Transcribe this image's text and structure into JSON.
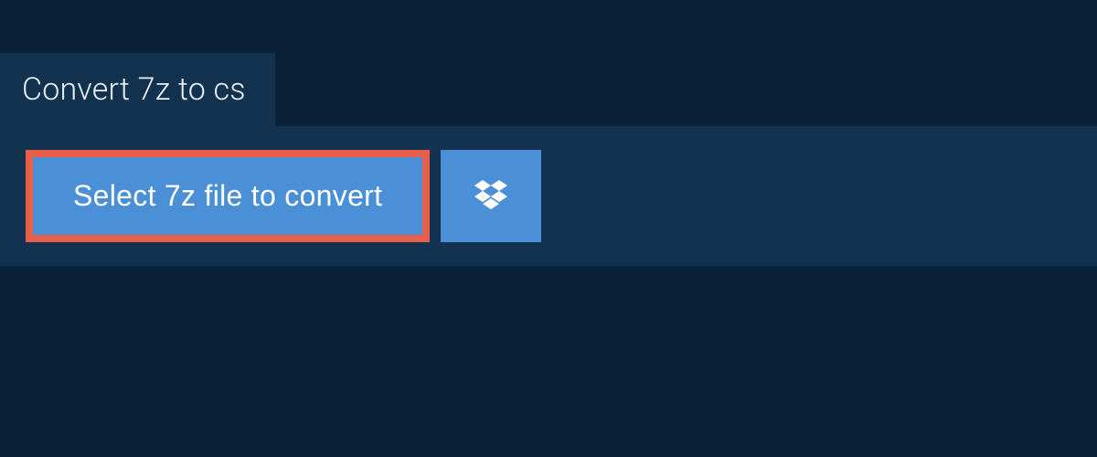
{
  "tab": {
    "label": "Convert 7z to cs"
  },
  "actions": {
    "select_label": "Select 7z file to convert"
  }
}
